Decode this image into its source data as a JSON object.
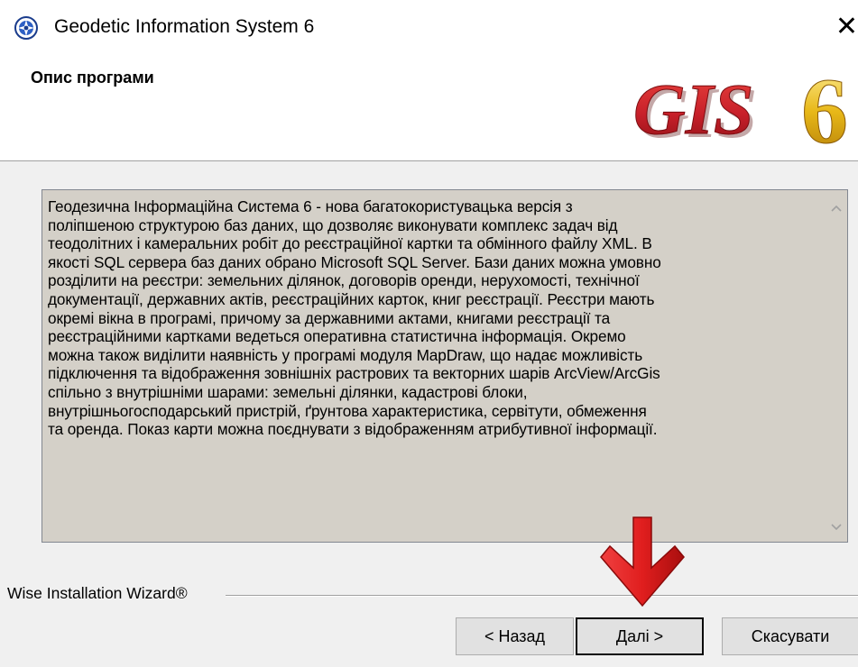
{
  "window": {
    "title": "Geodetic Information System 6",
    "close_glyph": "✕"
  },
  "header": {
    "title": "Опис програми",
    "logo_text": "GIS",
    "logo_number": "6"
  },
  "description": {
    "text": "Геодезична Інформаційна Система 6 - нова багатокористувацька версія з\nполіпшеною структурою баз даних, що дозволяє виконувати комплекс задач від\nтеодолітних і камеральних робіт до реєстраційної картки та обмінного файлу XML. В\nякості SQL сервера баз даних обрано Microsoft SQL Server. Бази даних можна умовно\nрозділити на реєстри: земельних ділянок, договорів оренди, нерухомості, технічної\nдокументації, державних актів, реєстраційних карток, книг реєстрації. Реєстри мають\nокремі вікна в програмі, причому за державними актами, книгами реєстрації та\nреєстраційними картками ведеться оперативна статистична інформація. Окремо\nможна також виділити наявність у програмі модуля MapDraw, що надає можливість\nпідключення та відображення зовнішніх растрових та векторних шарів ArcView/ArcGis\nспільно з внутрішніми шарами: земельні ділянки, кадастрові блоки,\nвнутрішньогосподарський пристрій, ґрунтова характеристика, сервітути, обмеження\nта оренда. Показ карти можна поєднувати з відображенням атрибутивної інформації."
  },
  "footer": {
    "wizard_label": "Wise Installation Wizard®",
    "back_label": "< Назад",
    "next_label": "Далі >",
    "cancel_label": "Скасувати"
  },
  "icons": {
    "app": "gis-app-icon",
    "scroll_up": "scroll-up-arrow",
    "scroll_down": "scroll-down-arrow",
    "annotation": "red-down-arrow"
  },
  "colors": {
    "logo_red": "#c8202a",
    "logo_gold": "#e8b818",
    "arrow_red": "#e01e1e"
  }
}
